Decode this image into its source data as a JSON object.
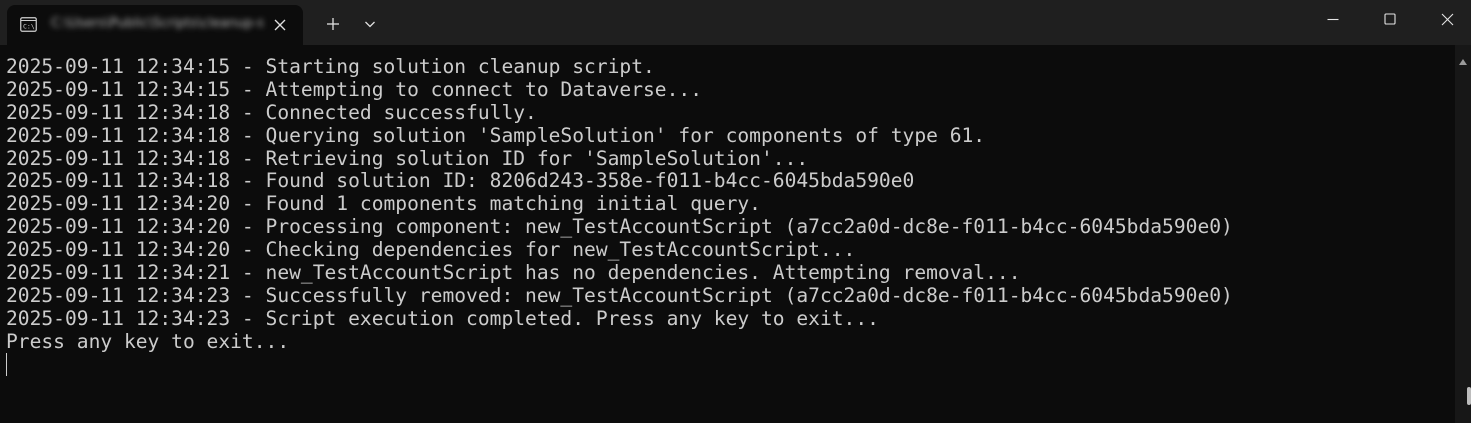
{
  "window": {
    "tab_title": "C:\\Users\\Public\\Scripts\\cleanup-solution.bat",
    "tab_icon": "console-icon",
    "new_tab_icon": "plus-icon",
    "dropdown_icon": "chevron-down-icon",
    "controls": [
      "minimize-icon",
      "maximize-icon",
      "close-icon"
    ]
  },
  "console": {
    "lines": [
      "2025-09-11 12:34:15 - Starting solution cleanup script.",
      "2025-09-11 12:34:15 - Attempting to connect to Dataverse...",
      "2025-09-11 12:34:18 - Connected successfully.",
      "2025-09-11 12:34:18 - Querying solution 'SampleSolution' for components of type 61.",
      "2025-09-11 12:34:18 - Retrieving solution ID for 'SampleSolution'...",
      "2025-09-11 12:34:18 - Found solution ID: 8206d243-358e-f011-b4cc-6045bda590e0",
      "2025-09-11 12:34:20 - Found 1 components matching initial query.",
      "2025-09-11 12:34:20 - Processing component: new_TestAccountScript (a7cc2a0d-dc8e-f011-b4cc-6045bda590e0)",
      "2025-09-11 12:34:20 - Checking dependencies for new_TestAccountScript...",
      "2025-09-11 12:34:21 - new_TestAccountScript has no dependencies. Attempting removal...",
      "2025-09-11 12:34:23 - Successfully removed: new_TestAccountScript (a7cc2a0d-dc8e-f011-b4cc-6045bda590e0)",
      "2025-09-11 12:34:23 - Script execution completed. Press any key to exit...",
      "Press any key to exit..."
    ]
  },
  "colors": {
    "console_bg": "#0c0c0c",
    "titlebar_bg": "#1f1f1f",
    "text": "#cccccc"
  }
}
